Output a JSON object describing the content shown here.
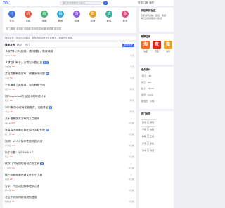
{
  "header": {
    "logo": "ZOL",
    "search_placeholder": "输入您想搜索的关键词",
    "search_icon": "search-icon",
    "right_links": "登录  注册  我的"
  },
  "nav": {
    "items": [
      {
        "label": "社区",
        "icon": "community-icon",
        "color": "#3a6ee8",
        "glyph": "社"
      },
      {
        "label": "手机",
        "icon": "phone-icon",
        "color": "#e8533a",
        "glyph": "机"
      },
      {
        "label": "电脑",
        "icon": "laptop-icon",
        "color": "#3ab56e",
        "glyph": "脑"
      },
      {
        "label": "数码",
        "icon": "camera-icon",
        "color": "#28a8d8",
        "glyph": "码"
      },
      {
        "label": "游戏",
        "icon": "game-icon",
        "color": "#8a52e0",
        "glyph": "游"
      },
      {
        "label": "影音",
        "icon": "media-icon",
        "color": "#e5a020",
        "glyph": "影"
      },
      {
        "label": "软件",
        "icon": "software-icon",
        "color": "#36b0a0",
        "glyph": "软"
      },
      {
        "label": "更多",
        "icon": "more-icon",
        "color": "#e04a7a",
        "glyph": "多"
      }
    ],
    "sub_links": "热门  推荐  手机圈  电脑圈  数码圈  游戏圈  软件圈  摄影圈"
  },
  "banner": "网站公告：欢迎访问本站，发布内容请遵守社区规范，感谢您的支持。",
  "tabs": {
    "items": [
      "最新发布",
      "精华",
      "热门"
    ],
    "post_button": "发布帖子"
  },
  "posts": [
    {
      "title": "【软件】小巧实用，随开随用，推荐收藏",
      "badge": "",
      "author": "admin",
      "views": "1,284",
      "time": "今天"
    },
    {
      "title": "【教程】新手入门常见问题汇总",
      "badge": "置顶",
      "author": "编辑部",
      "views": "986",
      "time": "今天"
    },
    {
      "title": "某应用最新版发布，修复多项问题",
      "badge": "精",
      "author": "小明",
      "views": "754",
      "time": "今天"
    },
    {
      "title": "手机清理工具推荐，轻松释放空间",
      "badge": "",
      "author": "用户01",
      "views": "632",
      "time": "昨天"
    },
    {
      "title": "用Thunderbolt外接显卡的体验分享",
      "badge": "",
      "author": "极客",
      "views": "521",
      "time": "昨天"
    },
    {
      "title": "2022新版小说阅读器推荐，功能齐全",
      "badge": "精",
      "author": "书虫",
      "views": "488",
      "time": "昨天"
    },
    {
      "title": "关于最新版本发布的几点说明",
      "badge": "",
      "author": "admin",
      "views": "455",
      "time": "2天前"
    },
    {
      "title": "来看看大家最近都在用什么软件吧",
      "badge": "热",
      "author": "路人甲",
      "views": "402",
      "time": "2天前"
    },
    {
      "title": "实测：v3.0.2 版本性能对比评测",
      "badge": "",
      "author": "评测君",
      "views": "376",
      "time": "3天前"
    },
    {
      "title": "新手必看：1 2 3 4 5 6 7",
      "badge": "",
      "author": "版主",
      "views": "341",
      "time": "3天前"
    },
    {
      "title": "推荐几个好用的自动点击工具",
      "badge": "精",
      "author": "工具控",
      "views": "310",
      "time": "4天前"
    },
    {
      "title": "找一款能批量处理文件的小工具",
      "badge": "",
      "author": "求助",
      "views": "287",
      "time": "4天前"
    },
    {
      "title": "分享一个自动化脚本使用心得",
      "badge": "",
      "author": "脚本侠",
      "views": "266",
      "time": "5天前"
    },
    {
      "title": "老旧手机如何继续流畅使用",
      "badge": "",
      "author": "数码迷",
      "views": "241",
      "time": "5天前"
    }
  ],
  "side_user": {
    "title": "欢迎来到社区",
    "lines": [
      "登录后可发帖、回复、收藏",
      "每日签到领取积分奖励"
    ]
  },
  "side_apps": {
    "title": "推荐应用",
    "tiles": [
      {
        "label": "淘宝",
        "icon": "taobao-icon",
        "color": "#f26b1f",
        "glyph": "淘"
      },
      {
        "label": "京东",
        "icon": "jd-icon",
        "color": "#e2231a",
        "glyph": "京"
      },
      {
        "label": "微博",
        "icon": "weibo-icon",
        "color": "#f0a020",
        "glyph": "微"
      }
    ]
  },
  "side_stats": {
    "title": "站点统计",
    "lines": [
      "今日：128",
      "昨日：356",
      "帖子：52,416",
      "会员：8,920",
      "新会员：小明"
    ]
  },
  "side_tags": {
    "title": "热门标签",
    "rows": [
      [
        "软件",
        "游戏"
      ],
      [
        "手机",
        "电脑"
      ],
      [
        "教程",
        "工具"
      ],
      [
        "评测",
        "求助"
      ],
      [
        "分享",
        "资源"
      ]
    ]
  }
}
